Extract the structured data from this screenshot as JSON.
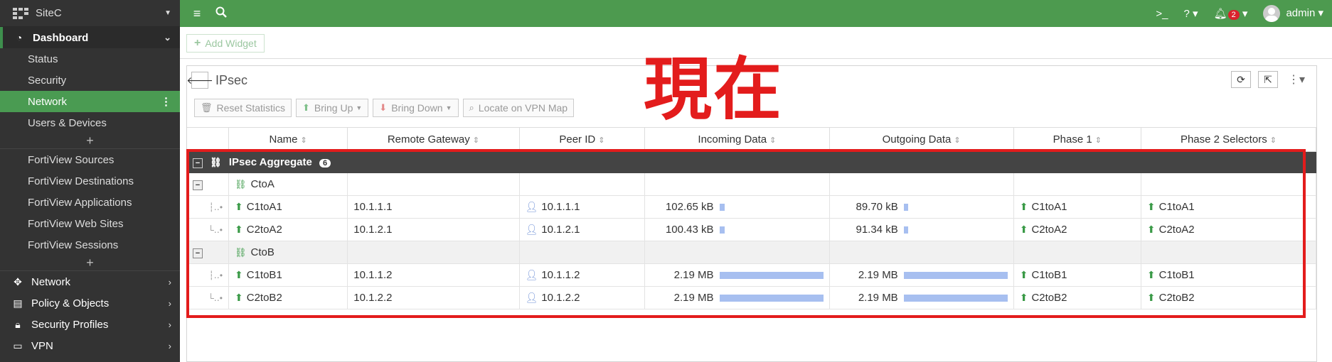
{
  "sidebar": {
    "device_name": "SiteC",
    "dashboard_label": "Dashboard",
    "dashboard_items": [
      "Status",
      "Security",
      "Network",
      "Users & Devices"
    ],
    "active_item": "Network",
    "fortiview_items": [
      "FortiView Sources",
      "FortiView Destinations",
      "FortiView Applications",
      "FortiView Web Sites",
      "FortiView Sessions"
    ],
    "sections": [
      {
        "label": "Network",
        "icon": "move-icon"
      },
      {
        "label": "Policy & Objects",
        "icon": "policy-icon"
      },
      {
        "label": "Security Profiles",
        "icon": "lock-icon"
      },
      {
        "label": "VPN",
        "icon": "laptop-icon"
      }
    ]
  },
  "topbar": {
    "notification_count": "2",
    "user": "admin"
  },
  "content": {
    "add_widget_label": "Add Widget"
  },
  "widget": {
    "title": "IPsec",
    "toolbar": {
      "reset": "Reset Statistics",
      "bring_up": "Bring Up",
      "bring_down": "Bring Down",
      "locate": "Locate on VPN Map"
    },
    "columns": [
      "Name",
      "Remote Gateway",
      "Peer ID",
      "Incoming Data",
      "Outgoing Data",
      "Phase 1",
      "Phase 2 Selectors"
    ],
    "aggregate": {
      "name": "IPsec Aggregate",
      "count": "6"
    },
    "groups": [
      {
        "name": "CtoA",
        "rows": [
          {
            "name": "C1toA1",
            "gateway": "10.1.1.1",
            "peer": "10.1.1.1",
            "incoming": "102.65 kB",
            "incoming_fraction": 0.05,
            "outgoing": "89.70 kB",
            "outgoing_fraction": 0.04,
            "phase1": "C1toA1",
            "phase2": "C1toA1"
          },
          {
            "name": "C2toA2",
            "gateway": "10.1.2.1",
            "peer": "10.1.2.1",
            "incoming": "100.43 kB",
            "incoming_fraction": 0.05,
            "outgoing": "91.34 kB",
            "outgoing_fraction": 0.04,
            "phase1": "C2toA2",
            "phase2": "C2toA2"
          }
        ]
      },
      {
        "name": "CtoB",
        "rows": [
          {
            "name": "C1toB1",
            "gateway": "10.1.1.2",
            "peer": "10.1.1.2",
            "incoming": "2.19 MB",
            "incoming_fraction": 1.0,
            "outgoing": "2.19 MB",
            "outgoing_fraction": 1.0,
            "phase1": "C1toB1",
            "phase2": "C1toB1"
          },
          {
            "name": "C2toB2",
            "gateway": "10.1.2.2",
            "peer": "10.1.2.2",
            "incoming": "2.19 MB",
            "incoming_fraction": 1.0,
            "outgoing": "2.19 MB",
            "outgoing_fraction": 1.0,
            "phase1": "C2toB2",
            "phase2": "C2toB2"
          }
        ]
      }
    ]
  },
  "annotation": {
    "text": "現在",
    "color": "#e31c1c"
  },
  "colors": {
    "accent": "#4d9a4f",
    "sidebar_bg": "#333333",
    "bar": "#a7bff0",
    "highlight": "#e31c1c"
  }
}
